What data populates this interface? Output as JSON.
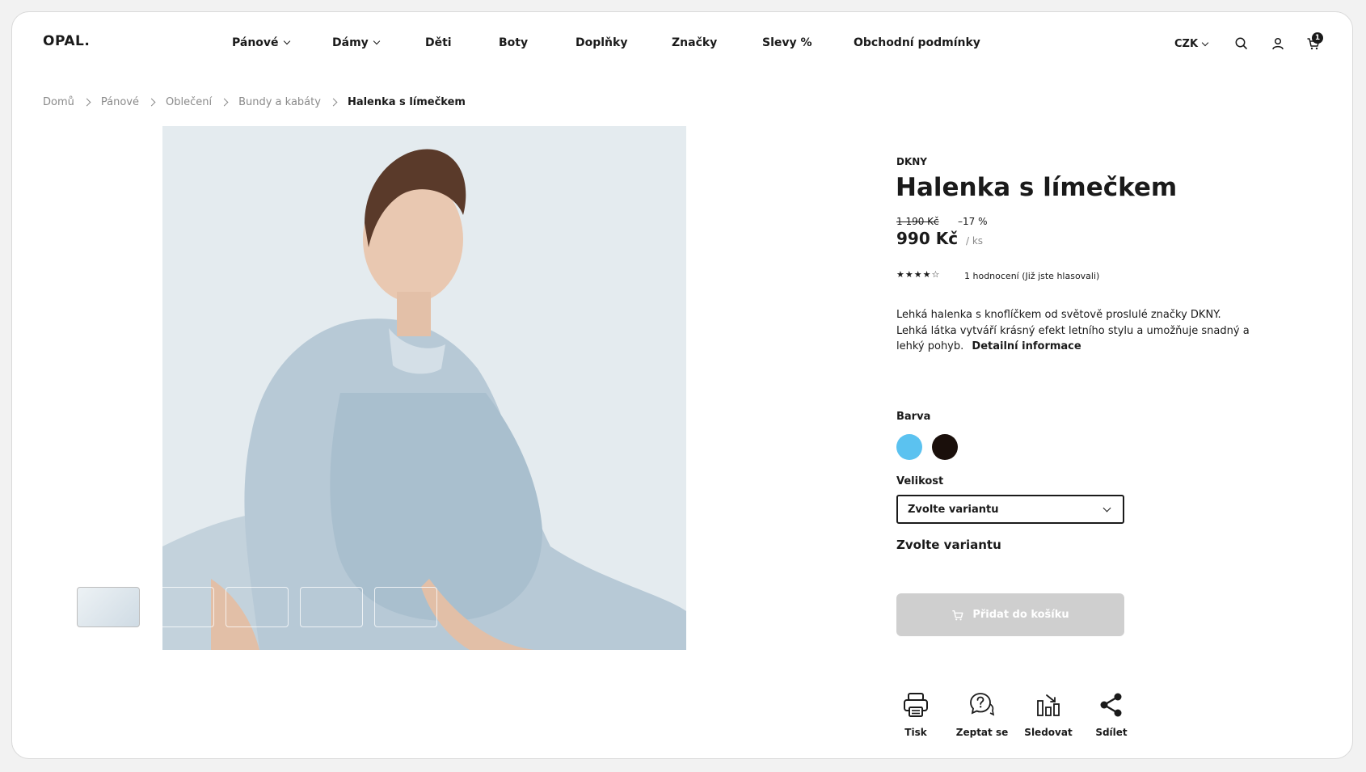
{
  "header": {
    "logo": "OPAL.",
    "nav": [
      {
        "label": "Pánové",
        "dropdown": true
      },
      {
        "label": "Dámy",
        "dropdown": true
      },
      {
        "label": "Děti",
        "dropdown": false
      },
      {
        "label": "Boty",
        "dropdown": false
      },
      {
        "label": "Doplňky",
        "dropdown": false
      },
      {
        "label": "Značky",
        "dropdown": false
      },
      {
        "label": "Slevy %",
        "dropdown": false
      },
      {
        "label": "Obchodní podmínky",
        "dropdown": false
      }
    ],
    "currency": "CZK",
    "cart_count": "1",
    "icons": [
      "search-icon",
      "user-icon",
      "cart-icon"
    ]
  },
  "breadcrumb": [
    "Domů",
    "Pánové",
    "Oblečení",
    "Bundy a kabáty",
    "Halenka s límečkem"
  ],
  "gallery": {
    "thumbnail_count": 5,
    "active_index": 0
  },
  "product": {
    "brand": "DKNY",
    "title": "Halenka s límečkem",
    "old_price": "1 190 Kč",
    "discount": "–17 %",
    "price": "990 Kč",
    "unit": "/ ks",
    "stars": "★★★★☆",
    "rating": 4,
    "rating_text": "1 hodnocení (Již jste hlasovali)",
    "description": "Lehká halenka s knoflíčkem od světově proslulé značky DKNY. Lehká látka vytváří krásný efekt letního stylu a umožňuje snadný a lehký pohyb.",
    "description_link": "Detailní informace",
    "color_label": "Barva",
    "colors": [
      "#5bc2f0",
      "#1a0f0b"
    ],
    "size_label": "Velikost",
    "size_select_value": "Zvolte variantu",
    "variant_note": "Zvolte variantu",
    "add_to_cart": "Přidat do košíku"
  },
  "actions": [
    {
      "label": "Tisk",
      "icon": "printer-icon"
    },
    {
      "label": "Zeptat se",
      "icon": "question-chat-icon"
    },
    {
      "label": "Sledovat",
      "icon": "watch-chart-icon"
    },
    {
      "label": "Sdílet",
      "icon": "share-icon"
    }
  ]
}
